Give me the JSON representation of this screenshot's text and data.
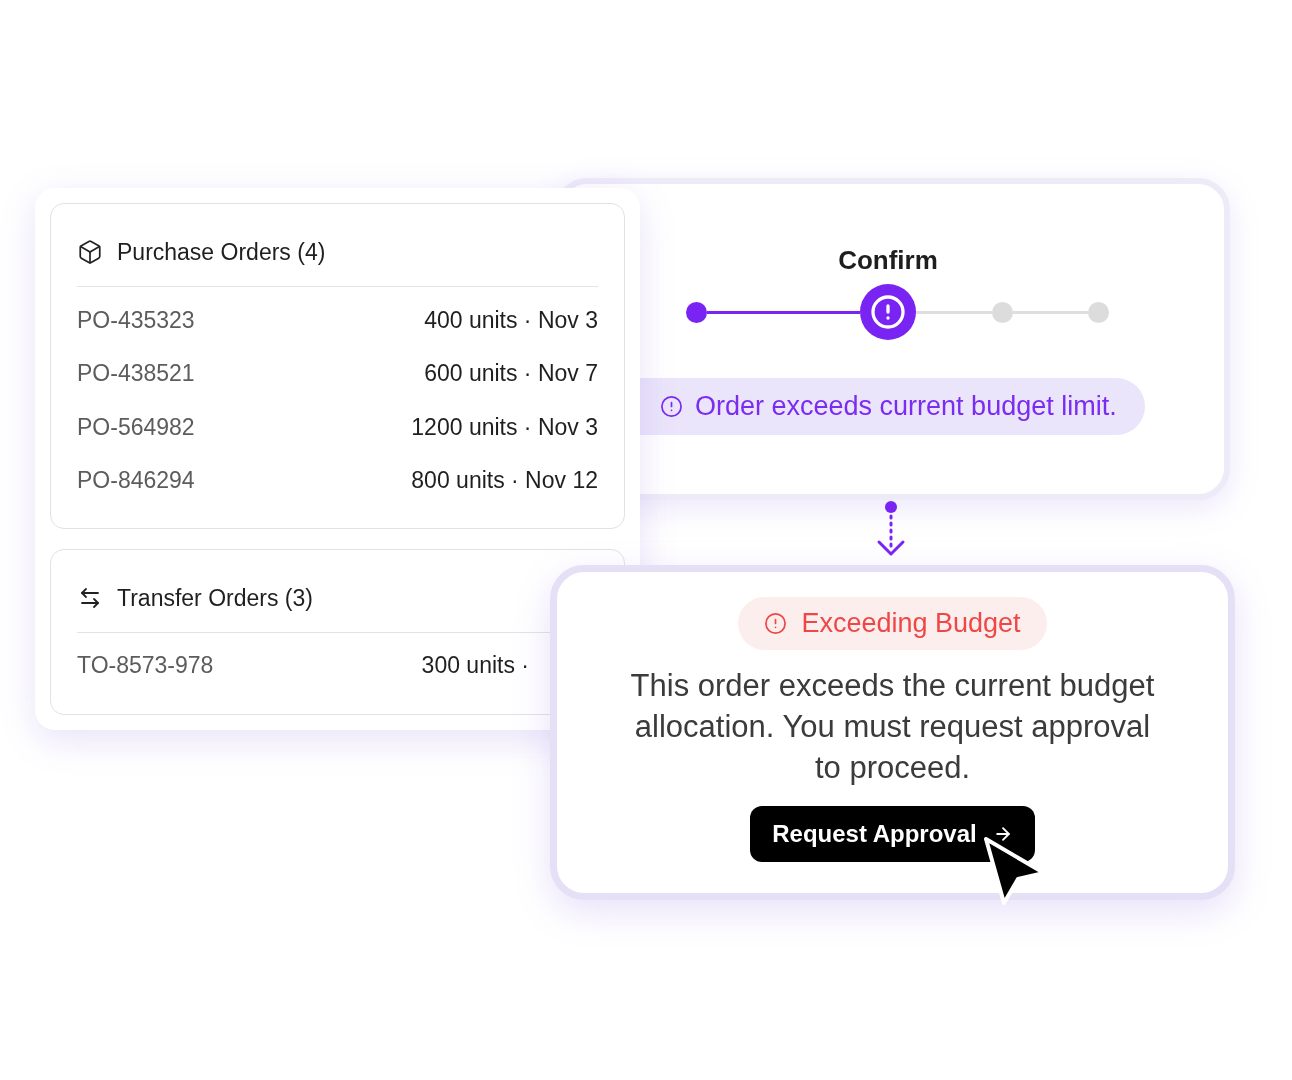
{
  "purchase_orders": {
    "title": "Purchase Orders (4)",
    "rows": [
      {
        "id": "PO-435323",
        "details": "400 units · Nov 3"
      },
      {
        "id": "PO-438521",
        "details": "600 units · Nov 7"
      },
      {
        "id": "PO-564982",
        "details": "1200 units · Nov 3"
      },
      {
        "id": "PO-846294",
        "details": "800 units · Nov 12"
      }
    ]
  },
  "transfer_orders": {
    "title": "Transfer Orders (3)",
    "rows": [
      {
        "id": "TO-8573-978",
        "details": "300 units ·"
      }
    ]
  },
  "stepper": {
    "steps": [
      {
        "kind": "complete"
      },
      {
        "kind": "current",
        "label": "Confirm"
      },
      {
        "kind": "upcoming"
      },
      {
        "kind": "upcoming"
      }
    ]
  },
  "alert": {
    "text": "Order exceeds current budget limit."
  },
  "budget_dialog": {
    "badge": "Exceeding Budget",
    "message": "This order exceeds the current budget allocation. You must request approval to proceed.",
    "button": "Request Approval"
  }
}
